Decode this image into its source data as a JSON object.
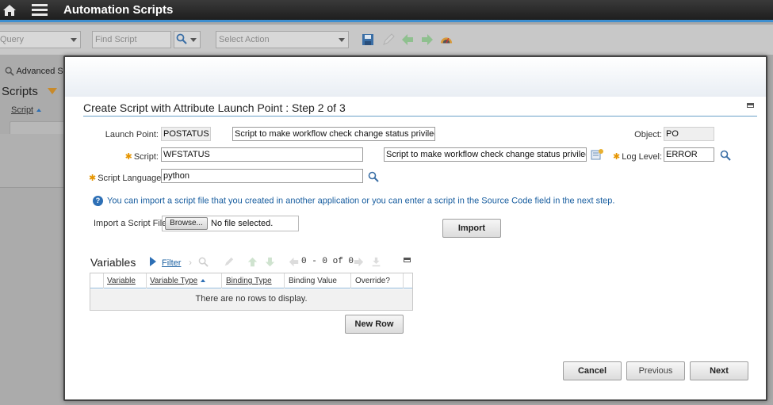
{
  "app": {
    "title": "Automation Scripts"
  },
  "toolbar": {
    "query_placeholder": "Query",
    "find_placeholder": "Find Script",
    "action_placeholder": "Select Action"
  },
  "background": {
    "advanced_search": "Advanced Se",
    "list_title": "Scripts",
    "column_script": "Script"
  },
  "dialog": {
    "title": "Create Script with Attribute Launch Point : Step 2 of 3",
    "launch_point_label": "Launch Point:",
    "launch_point_value": "POSTATUS",
    "launch_point_desc": "Script to make workflow check change status privileges",
    "object_label": "Object:",
    "object_value": "PO",
    "script_label": "Script:",
    "script_value": "WFSTATUS",
    "script_desc": "Script to make workflow check change status privileges",
    "log_level_label": "Log Level:",
    "log_level_value": "ERROR",
    "language_label": "Script Language:",
    "language_value": "python",
    "info_text": "You can import a script file that you created in another application or you can enter a script in the Source Code field in the next step.",
    "import_label": "Import a Script File:",
    "browse_label": "Browse...",
    "no_file": "No file selected.",
    "import_button": "Import"
  },
  "variables": {
    "title": "Variables",
    "filter_label": "Filter",
    "pager": "0 - 0 of 0",
    "columns": [
      "Variable",
      "Variable Type",
      "Binding Type",
      "Binding Value",
      "Override?"
    ],
    "empty_message": "There are no rows to display.",
    "new_row_button": "New Row"
  },
  "footer": {
    "cancel": "Cancel",
    "previous": "Previous",
    "next": "Next"
  },
  "colors": {
    "accent": "#3e8fd0",
    "link": "#1a5fa0",
    "required": "#e69500"
  }
}
